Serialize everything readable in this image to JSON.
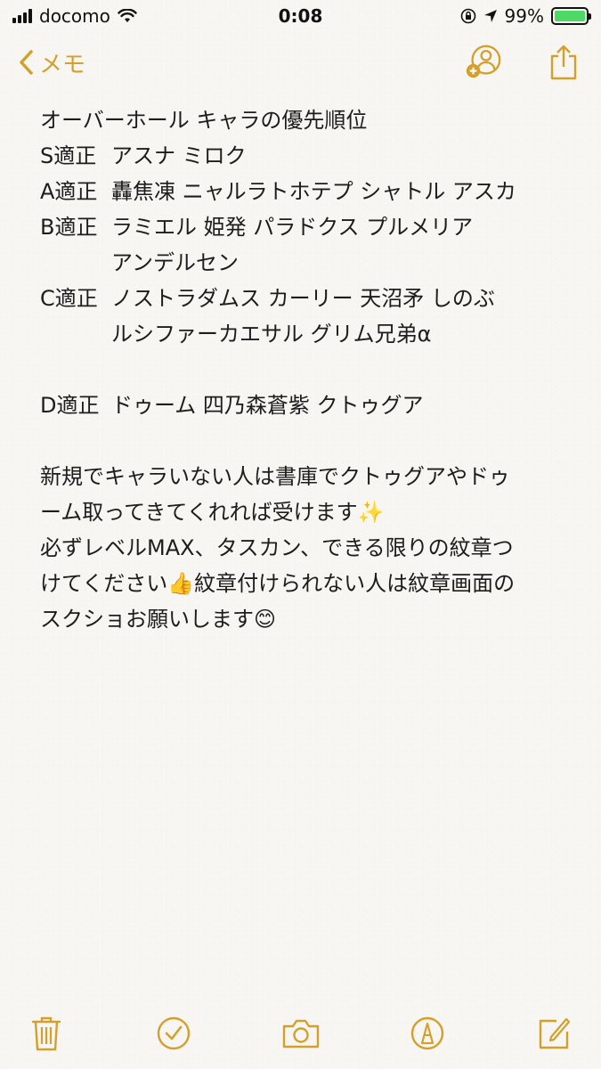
{
  "status_bar": {
    "carrier": "docomo",
    "time": "0:08",
    "battery": "99%",
    "battery_level": 0.99
  },
  "nav": {
    "back_label": "メモ"
  },
  "note": {
    "title": "オーバーホール キャラの優先順位",
    "tiers": [
      {
        "label": "S適正",
        "lines": [
          "アスナ ミロク"
        ]
      },
      {
        "label": "A適正",
        "lines": [
          "轟焦凍 ニャルラトホテプ シャトル アスカ"
        ]
      },
      {
        "label": "B適正",
        "lines": [
          "ラミエル 姫発 パラドクス プルメリア",
          "アンデルセン"
        ]
      },
      {
        "label": "C適正",
        "lines": [
          "ノストラダムス カーリー 天沼矛 しのぶ",
          "ルシファーカエサル グリム兄弟α"
        ]
      },
      {
        "label": "D適正",
        "lines": [
          "ドゥーム 四乃森蒼紫 クトゥグア"
        ]
      }
    ],
    "paragraph": [
      "新規でキャラいない人は書庫でクトゥグアやドゥ",
      "ーム取ってきてくれれば受けます✨",
      "必ずレベルMAX、タスカン、できる限りの紋章つ",
      "けてください👍紋章付けられない人は紋章画面の",
      "スクショお願いします😊"
    ]
  },
  "colors": {
    "accent": "#d4a02c",
    "text": "#1d1d1d",
    "background": "#f7f6f3"
  },
  "toolbar": {
    "icons": [
      "trash-icon",
      "checklist-icon",
      "camera-icon",
      "markup-icon",
      "compose-icon"
    ]
  }
}
